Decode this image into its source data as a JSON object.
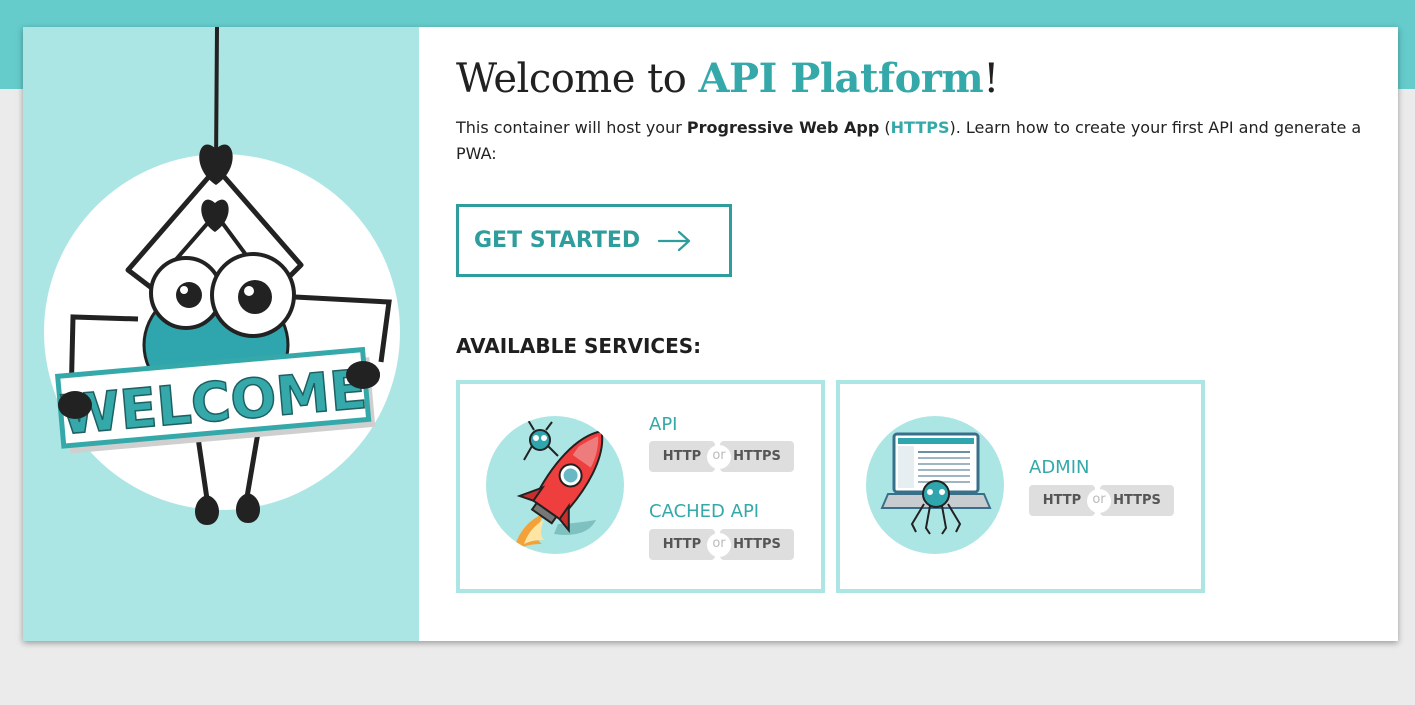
{
  "hero": {
    "title_prefix": "Welcome to ",
    "title_brand": "API Platform",
    "title_suffix": "!",
    "desc_1": "This container will host your ",
    "desc_bold": "Progressive Web App",
    "desc_2": " (",
    "desc_link": "HTTPS",
    "desc_3": "). Learn how to create your first API and generate a PWA:"
  },
  "mascot": {
    "sign_text": "WELCOME"
  },
  "get_started": {
    "label": "GET STARTED",
    "icon": "arrow-right-icon"
  },
  "services": {
    "heading": "AVAILABLE SERVICES:",
    "separator": "or",
    "api": {
      "label": "API",
      "http": "HTTP",
      "https": "HTTPS",
      "icon": "rocket-icon"
    },
    "cached_api": {
      "label": "CACHED API",
      "http": "HTTP",
      "https": "HTTPS"
    },
    "admin": {
      "label": "ADMIN",
      "http": "HTTP",
      "https": "HTTPS",
      "icon": "laptop-icon"
    }
  },
  "colors": {
    "accent": "#35a9aa",
    "panel": "#ace6e4",
    "top_band": "#65cbcb",
    "pill": "#dedede"
  }
}
